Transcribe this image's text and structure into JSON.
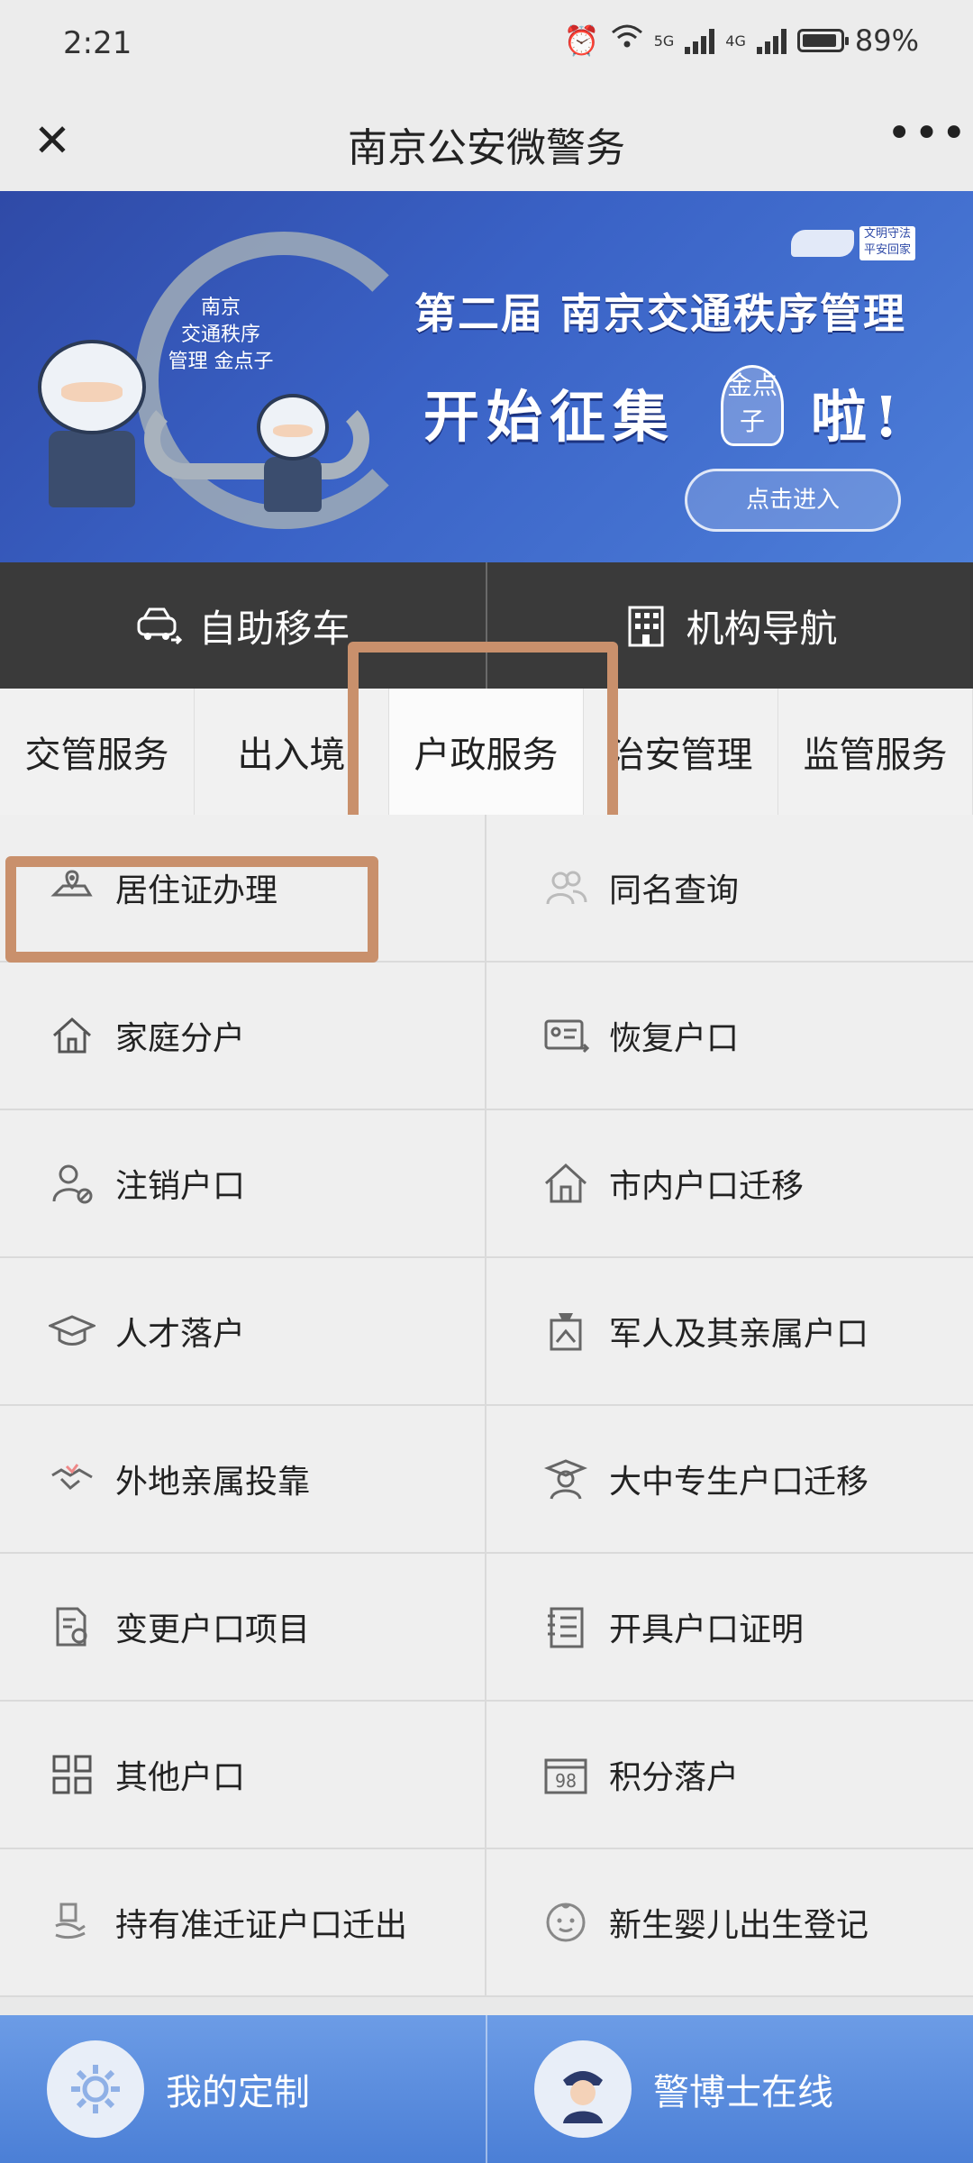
{
  "status_bar": {
    "time": "2:21",
    "battery": "89%",
    "network_1": "5G",
    "network_2": "4G"
  },
  "titlebar": {
    "title": "南京公安微警务",
    "close_icon": "close-icon",
    "more_icon": "more-icon"
  },
  "banner": {
    "headline": "第二届 南京交通秩序管理",
    "subline_left": "开始征集",
    "subline_right": "啦!",
    "badge_line1": "南京",
    "badge_line2": "交通秩序",
    "badge_line3": "管理 金点子",
    "bulb_text": "金点子",
    "corner_logo": "文明守法 平安回家",
    "enter_button": "点击进入"
  },
  "quick_actions": [
    {
      "label": "自助移车",
      "icon": "car-icon"
    },
    {
      "label": "机构导航",
      "icon": "building-icon"
    }
  ],
  "tabs": [
    {
      "label": "交管服务"
    },
    {
      "label": "出入境"
    },
    {
      "label": "户政服务",
      "active": true
    },
    {
      "label": "治安管理"
    },
    {
      "label": "监管服务"
    }
  ],
  "services": [
    {
      "label": "居住证办理",
      "icon": "location-card-icon"
    },
    {
      "label": "同名查询",
      "icon": "people-icon"
    },
    {
      "label": "家庭分户",
      "icon": "house-icon"
    },
    {
      "label": "恢复户口",
      "icon": "id-card-icon"
    },
    {
      "label": "注销户口",
      "icon": "user-cancel-icon"
    },
    {
      "label": "市内户口迁移",
      "icon": "home-move-icon"
    },
    {
      "label": "人才落户",
      "icon": "graduation-cap-icon"
    },
    {
      "label": "军人及其亲属户口",
      "icon": "military-icon"
    },
    {
      "label": "外地亲属投靠",
      "icon": "handshake-icon"
    },
    {
      "label": "大中专生户口迁移",
      "icon": "student-icon"
    },
    {
      "label": "变更户口项目",
      "icon": "document-edit-icon"
    },
    {
      "label": "开具户口证明",
      "icon": "certificate-icon"
    },
    {
      "label": "其他户口",
      "icon": "grid-icon"
    },
    {
      "label": "积分落户",
      "icon": "calendar-score-icon"
    },
    {
      "label": "持有准迁证户口迁出",
      "icon": "hand-document-icon"
    },
    {
      "label": "新生婴儿出生登记",
      "icon": "baby-icon"
    }
  ],
  "bottom_bar": [
    {
      "label": "我的定制",
      "icon": "gear-icon"
    },
    {
      "label": "警博士在线",
      "icon": "police-avatar-icon"
    }
  ],
  "colors": {
    "highlight_box": "#c9906c",
    "quick_bar": "#3a3a3a",
    "bottom_bar": "#5a8ce0",
    "banner": "#3a62c6"
  }
}
